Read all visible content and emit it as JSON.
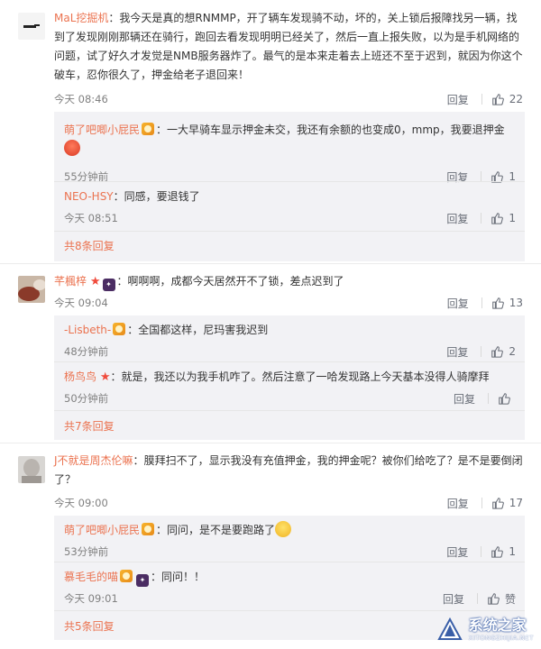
{
  "comments": [
    {
      "user": "MaL挖掘机",
      "text": "我今天是真的想RNMMP，开了辆车发现骑不动，坏的，关上锁后报障找另一辆，找到了发现刚刚那辆还在骑行，跑回去看发现明明已经关了，然后一直上报失败，以为是手机网络的问题，试了好久才发觉是NMB服务器炸了。最气的是本来走着去上班还不至于迟到，就因为你这个破车，忍你很久了，押金给老子退回来！",
      "time": "今天 08:46",
      "reply": "回复",
      "likes": "22",
      "replies": [
        {
          "user": "萌了吧唧小屁民",
          "text": "一大早骑车显示押金未交，我还有余额的也变成0，mmp，我要退押金",
          "time": "55分钟前",
          "reply": "回复",
          "likes": "1"
        },
        {
          "user": "NEO-HSY",
          "text": "同感，要退钱了",
          "time": "今天 08:51",
          "reply": "回复",
          "likes": "1"
        }
      ],
      "more": "共8条回复"
    },
    {
      "user": "芊楓梓",
      "text": "啊啊啊，成都今天居然开不了锁，差点迟到了",
      "time": "今天 09:04",
      "reply": "回复",
      "likes": "13",
      "replies": [
        {
          "user": "-Lisbeth-",
          "text": "全国都这样，尼玛害我迟到",
          "time": "48分钟前",
          "reply": "回复",
          "likes": "2"
        },
        {
          "user": "杨鸟鸟",
          "text": "就是，我还以为我手机咋了。然后注意了一哈发现路上今天基本没得人骑摩拜",
          "time": "50分钟前",
          "reply": "回复",
          "likes": ""
        }
      ],
      "more": "共7条回复"
    },
    {
      "user": "J不就是周杰伦嘛",
      "text": "膜拜扫不了，显示我没有充值押金，我的押金呢？被你们给吃了？是不是要倒闭了？",
      "time": "今天 09:00",
      "reply": "回复",
      "likes": "17",
      "replies": [
        {
          "user": "萌了吧唧小屁民",
          "text": "同问，是不是要跑路了",
          "time": "53分钟前",
          "reply": "回复",
          "likes": "1"
        },
        {
          "user": "慕毛毛的喵",
          "text": "同问！！",
          "time": "今天 09:01",
          "reply": "回复",
          "likes": "赞"
        }
      ],
      "more": "共5条回复"
    }
  ],
  "watermark": {
    "name": "系统之家",
    "url": "XITONGZHIJIA.NET"
  },
  "colors": {
    "username": "#eb7350",
    "subbox": "#f2f2f5",
    "muted": "#808080"
  }
}
